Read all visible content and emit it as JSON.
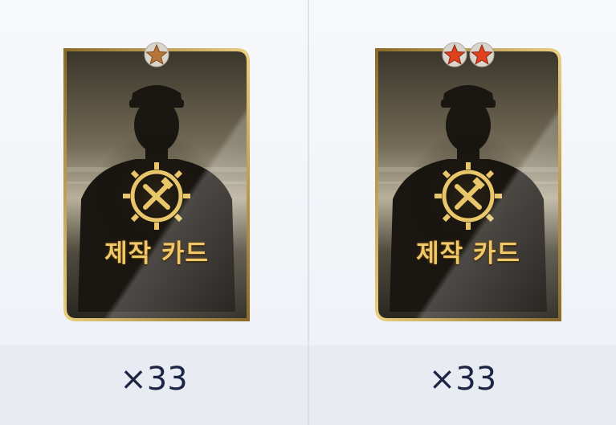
{
  "items": [
    {
      "stars": 1,
      "star_color": "#b8753a",
      "card_title": "제작 카드",
      "quantity": "×33"
    },
    {
      "stars": 2,
      "star_color": "#e0421e",
      "card_title": "제작 카드",
      "quantity": "×33"
    }
  ],
  "colors": {
    "card_border": "#c9a24a",
    "title_gold": "#f0c86a",
    "quantity_text": "#1c2544"
  },
  "icons": {
    "card_emblem": "gear-hammer-wrench-icon",
    "rank": "star-icon"
  }
}
